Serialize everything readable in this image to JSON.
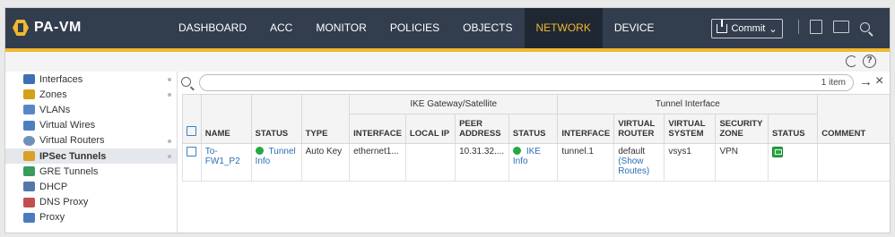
{
  "app": {
    "name": "PA-VM"
  },
  "nav": {
    "tabs": [
      {
        "label": "DASHBOARD",
        "active": false
      },
      {
        "label": "ACC",
        "active": false
      },
      {
        "label": "MONITOR",
        "active": false
      },
      {
        "label": "POLICIES",
        "active": false
      },
      {
        "label": "OBJECTS",
        "active": false
      },
      {
        "label": "NETWORK",
        "active": true
      },
      {
        "label": "DEVICE",
        "active": false
      }
    ],
    "commit_label": "Commit"
  },
  "colors": {
    "topbar": "#323d4e",
    "accent": "#f2b82e",
    "link": "#2b6fb5",
    "status_ok": "#28a745"
  },
  "sidebar": {
    "items": [
      {
        "label": "Interfaces",
        "icon": "interfaces-icon",
        "active": false
      },
      {
        "label": "Zones",
        "icon": "zones-icon",
        "active": false
      },
      {
        "label": "VLANs",
        "icon": "vlans-icon",
        "active": false
      },
      {
        "label": "Virtual Wires",
        "icon": "virtual-wires-icon",
        "active": false
      },
      {
        "label": "Virtual Routers",
        "icon": "virtual-routers-icon",
        "active": false
      },
      {
        "label": "IPSec Tunnels",
        "icon": "ipsec-tunnels-icon",
        "active": true
      },
      {
        "label": "GRE Tunnels",
        "icon": "gre-tunnels-icon",
        "active": false
      },
      {
        "label": "DHCP",
        "icon": "dhcp-icon",
        "active": false
      },
      {
        "label": "DNS Proxy",
        "icon": "dns-proxy-icon",
        "active": false
      },
      {
        "label": "Proxy",
        "icon": "proxy-icon",
        "active": false
      }
    ]
  },
  "search": {
    "count_label": "1 item"
  },
  "table": {
    "groups": {
      "ike": "IKE Gateway/Satellite",
      "tunnel": "Tunnel Interface"
    },
    "headers": {
      "name": "NAME",
      "status": "STATUS",
      "type": "TYPE",
      "ike_interface": "INTERFACE",
      "ike_local_ip": "LOCAL IP",
      "ike_peer": "PEER ADDRESS",
      "ike_status": "STATUS",
      "tun_interface": "INTERFACE",
      "tun_vr": "VIRTUAL ROUTER",
      "tun_vsys": "VIRTUAL SYSTEM",
      "tun_zone": "SECURITY ZONE",
      "tun_status": "STATUS",
      "comment": "COMMENT"
    },
    "rows": [
      {
        "name": "To-FW1_P2",
        "status": "Tunnel Info",
        "type": "Auto Key",
        "ike_interface": "ethernet1...",
        "ike_local_ip": "",
        "ike_peer": "10.31.32....",
        "ike_status": "IKE Info",
        "tun_interface": "tunnel.1",
        "tun_vr": "default",
        "tun_vr_link": "(Show Routes)",
        "tun_vsys": "vsys1",
        "tun_zone": "VPN",
        "tun_status": "up",
        "comment": ""
      }
    ]
  }
}
